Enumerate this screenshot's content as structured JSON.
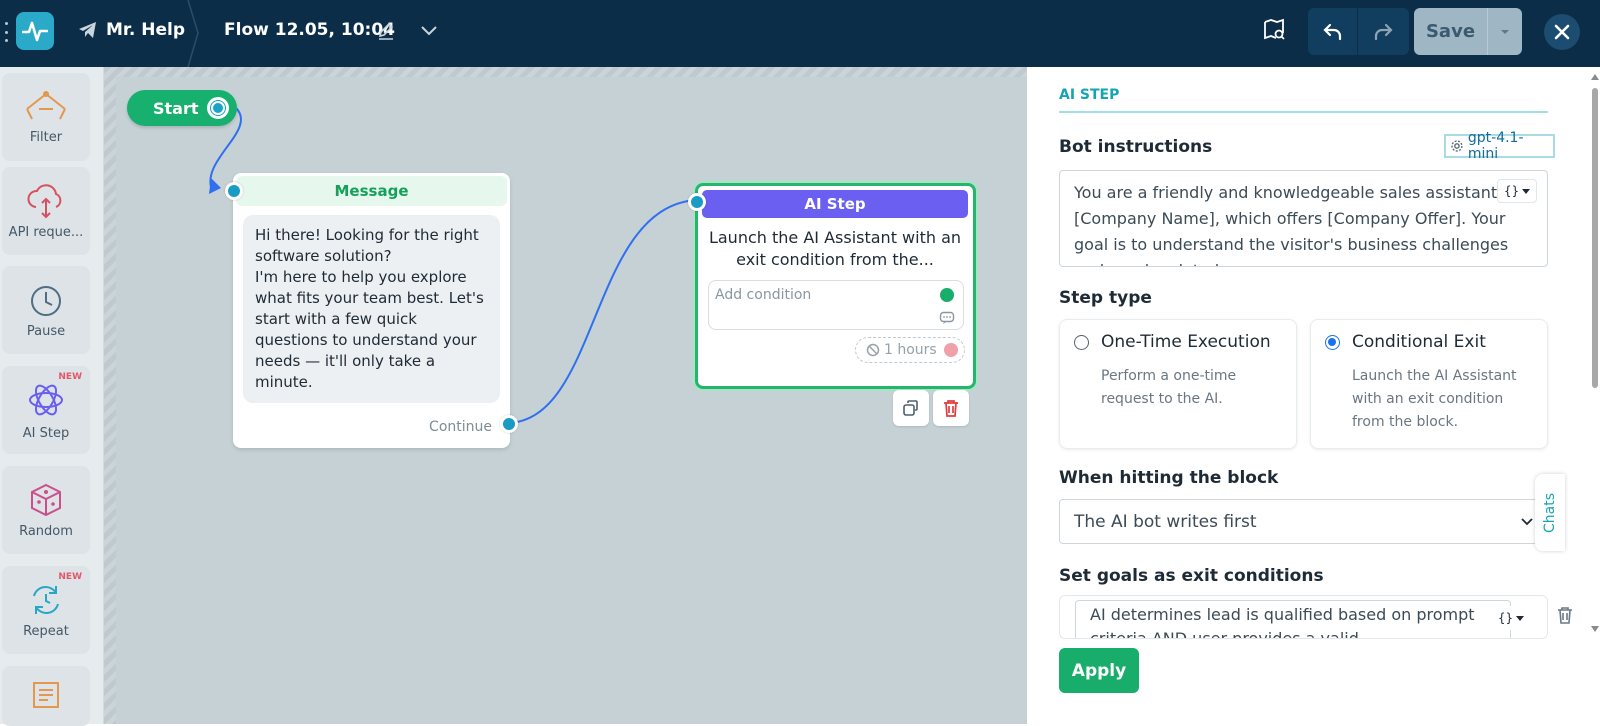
{
  "header": {
    "bot_name": "Mr. Help",
    "flow_name": "Flow 12.05, 10:04",
    "save_label": "Save"
  },
  "sidebar": {
    "items": [
      {
        "label": "Filter",
        "icon": "filter-icon",
        "new": ""
      },
      {
        "label": "API reque...",
        "icon": "cloud-api-icon",
        "new": ""
      },
      {
        "label": "Pause",
        "icon": "clock-icon",
        "new": ""
      },
      {
        "label": "AI Step",
        "icon": "atom-icon",
        "new": "NEW"
      },
      {
        "label": "Random",
        "icon": "dice-icon",
        "new": ""
      },
      {
        "label": "Repeat",
        "icon": "repeat-icon",
        "new": "NEW"
      }
    ]
  },
  "canvas": {
    "start_label": "Start",
    "message_node": {
      "title": "Message",
      "text": "Hi there! Looking for the right software solution?\nI'm here to help you explore what fits your team best. Let's start with a few quick questions to understand your needs — it'll only take a minute.",
      "continue_label": "Continue"
    },
    "ai_node": {
      "title": "AI Step",
      "description": "Launch the AI Assistant with an exit condition from the...",
      "condition_placeholder": "Add condition",
      "timeout": "1 hours"
    }
  },
  "panel": {
    "section_title": "AI STEP",
    "bot_instructions_label": "Bot instructions",
    "model": "gpt-4.1-mini",
    "instructions_text": "You are a friendly and knowledgeable sales assistant for [Company Name], which offers [Company Offer]. Your goal is to understand the visitor's business challenges and needs related",
    "step_type_label": "Step type",
    "step_types": [
      {
        "title": "One-Time Execution",
        "description": "Perform a one-time request to the AI.",
        "selected": false
      },
      {
        "title": "Conditional Exit",
        "description": "Launch the AI Assistant with an exit condition from the block.",
        "selected": true
      }
    ],
    "hitting_label": "When hitting the block",
    "hitting_value": "The AI bot writes first",
    "goals_label": "Set goals as exit conditions",
    "goal_text": "AI determines lead is qualified based on prompt criteria AND user provides a valid",
    "apply_label": "Apply"
  },
  "chats_tab": "Chats",
  "colors": {
    "topbar": "#0b2d48",
    "accent_green": "#19ad6c",
    "ai_purple": "#6a5ff0",
    "teal": "#14a4b3"
  }
}
